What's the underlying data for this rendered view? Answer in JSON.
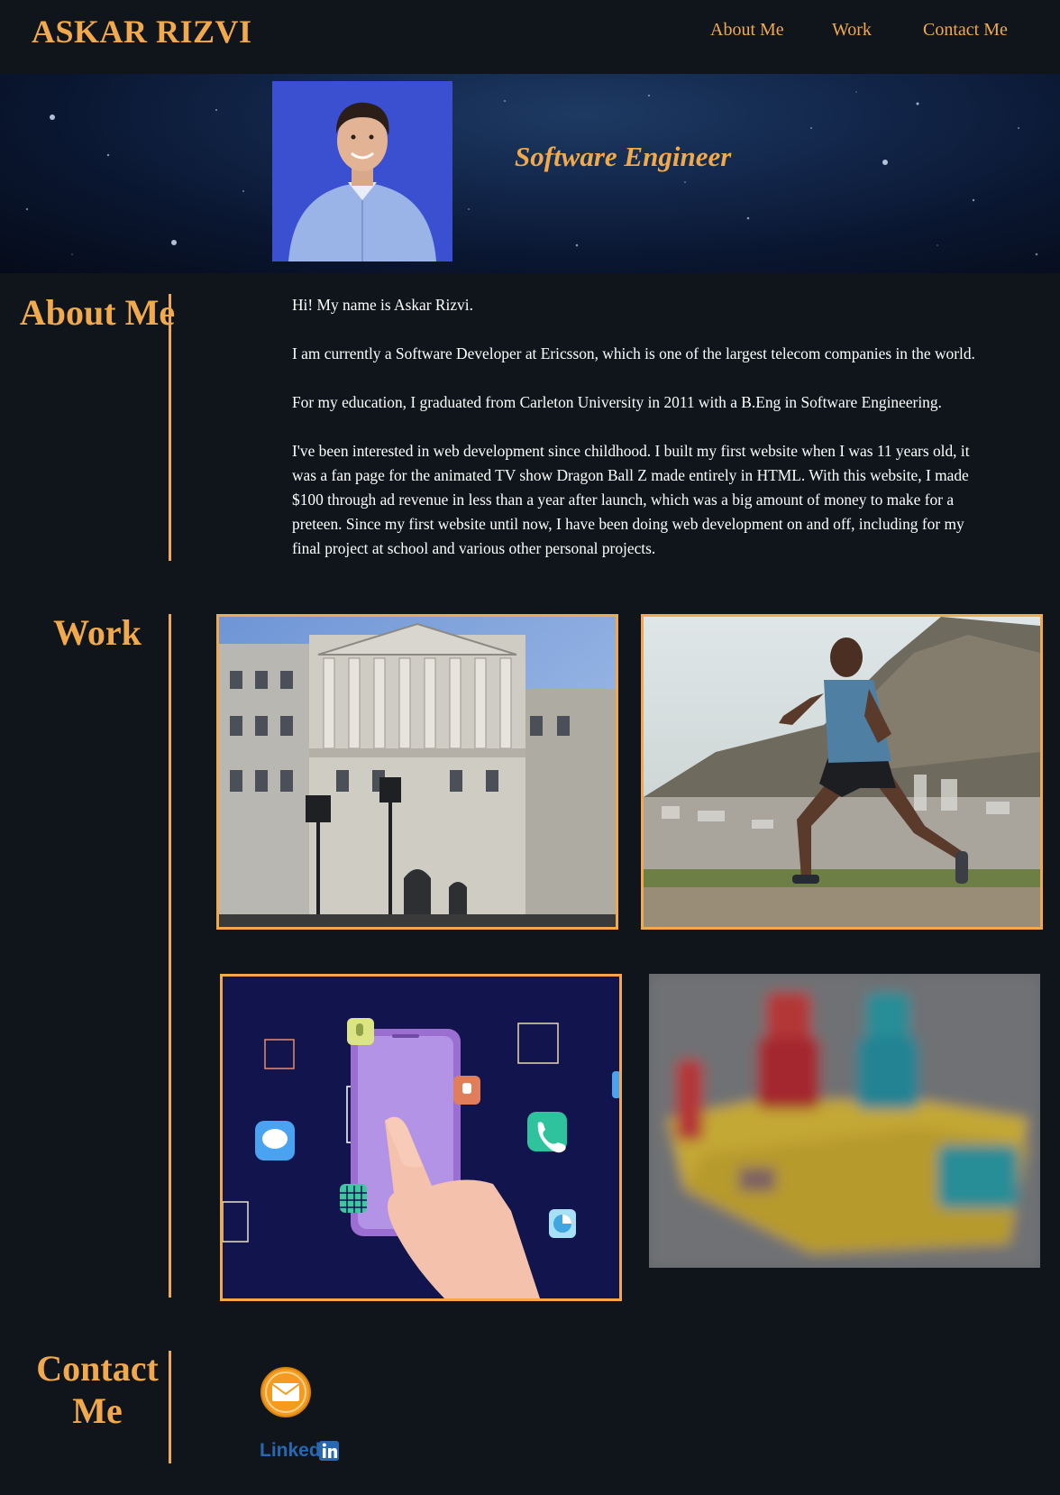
{
  "header": {
    "site_title": "ASKAR RIZVI",
    "nav": [
      {
        "label": "About Me"
      },
      {
        "label": "Work"
      },
      {
        "label": "Contact Me"
      }
    ]
  },
  "hero": {
    "subtitle": "Software Engineer"
  },
  "about": {
    "heading": "About Me",
    "paragraphs": [
      "Hi! My name is Askar Rizvi.",
      "I am currently a Software Developer at Ericsson, which is one of the largest telecom companies in the world.",
      "For my education, I graduated from Carleton University in 2011 with a B.Eng in Software Engineering.",
      "I've been interested in web development since childhood. I built my first website when I was 11 years old, it was a fan page for the animated TV show Dragon Ball Z made entirely in HTML. With this website, I made $100 through ad revenue in less than a year after launch, which was a big amount of money to make for a preteen. Since my first website until now, I have been doing web development on and off, including for my final project at school and various other personal projects."
    ]
  },
  "work": {
    "heading": "Work"
  },
  "contact": {
    "heading": "Contact Me",
    "linkedin_text": "Linked"
  },
  "colors": {
    "accent": "#f1a94b",
    "background": "#0f151b",
    "text": "#ffffff",
    "linkedin": "#2867b2"
  }
}
